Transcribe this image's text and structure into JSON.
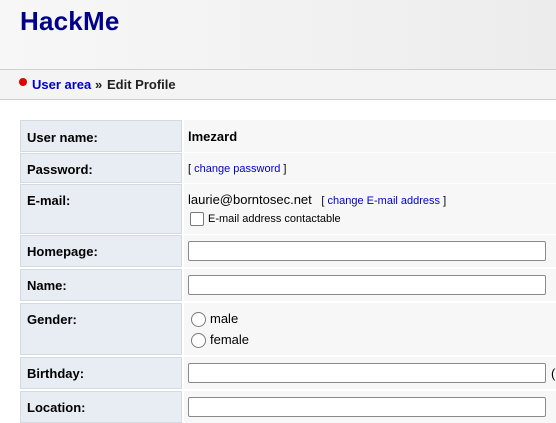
{
  "app": {
    "logo": "HackMe"
  },
  "breadcrumb": {
    "parent": "User area",
    "separator": "»",
    "current": "Edit Profile"
  },
  "form": {
    "username_label": "User name:",
    "username_value": "lmezard",
    "password_label": "Password:",
    "password_bracket_open": "[",
    "change_password_link": "change password",
    "password_bracket_close": "]",
    "email_label": "E-mail:",
    "email_value": "laurie@borntosec.net",
    "email_bracket_open": "[",
    "change_email_link": "change E-mail address",
    "email_bracket_close": "]",
    "email_contactable_label": "E-mail address contactable",
    "email_contactable_checked": false,
    "homepage_label": "Homepage:",
    "homepage_value": "",
    "name_label": "Name:",
    "name_value": "",
    "gender_label": "Gender:",
    "gender_options": [
      "male",
      "female"
    ],
    "birthday_label": "Birthday:",
    "birthday_value": "",
    "birthday_suffix": "(",
    "location_label": "Location:",
    "location_value": ""
  }
}
